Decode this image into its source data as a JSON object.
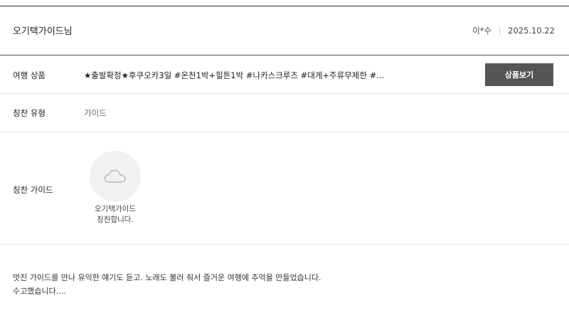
{
  "header": {
    "guide_name": "오기택가이드님",
    "author": "이*수",
    "date": "2025.10.22"
  },
  "product": {
    "label": "여행 상품",
    "name": "★출발확정★후쿠오카3일 #온천1박+힐튼1박 #나카스크루즈 #대게+주류무제한 #...",
    "button_label": "상품보기"
  },
  "praise_type": {
    "label": "칭찬 유형",
    "value": "가이드"
  },
  "praise_guide": {
    "label": "칭찬 가이드",
    "icon": "cloud-icon",
    "caption_line1": "오기택가이드",
    "caption_line2": "칭찬합니다."
  },
  "review": {
    "line1": "멋진 가이드를 만나 유익한 얘기도 듣고. 노래도 불러 줘서 즐거운 여행에 추억을 만들었습니다.",
    "line2": "수고했습니다...."
  }
}
